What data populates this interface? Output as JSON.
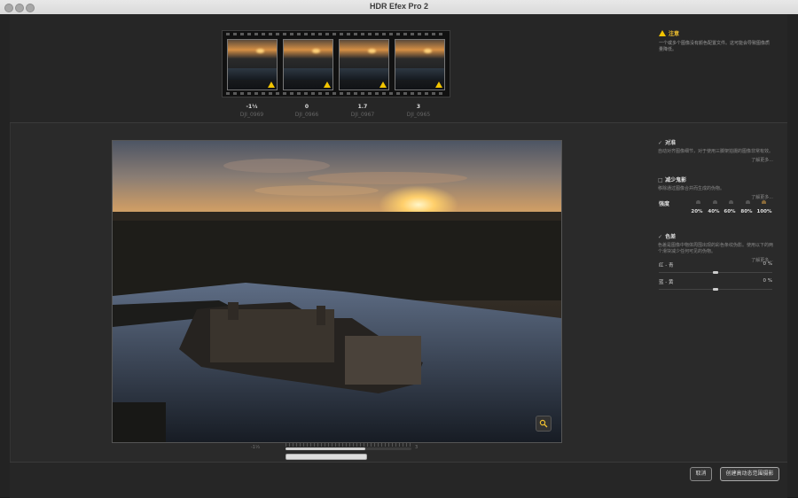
{
  "window": {
    "title": "HDR Efex Pro 2"
  },
  "filmstrip": [
    {
      "ev": "-1⅓",
      "name": "DJI_0969"
    },
    {
      "ev": "0",
      "name": "DJI_0966"
    },
    {
      "ev": "1.7",
      "name": "DJI_0967"
    },
    {
      "ev": "3",
      "name": "DJI_0965"
    }
  ],
  "notice": {
    "title": "注意",
    "text": "一个或多个图像没有颜色配置文件。这可能会导致图像质量降低。"
  },
  "alignment": {
    "title": "对准",
    "description": "自动对齐图像细节，对于使用三脚架拍摄的图像非常有效。",
    "more": "了解更多...",
    "checked": true
  },
  "ghost": {
    "title": "减少鬼影",
    "description": "移除通过图像合并而生成的伪物。",
    "more": "了解更多...",
    "checked": false,
    "strength_label": "强度",
    "strengths": [
      "20%",
      "40%",
      "60%",
      "80%",
      "100%"
    ]
  },
  "chroma": {
    "title": "色差",
    "description": "色差是图像中物体周围出现的彩色条纹伪影。使用以下的两个滑块减少任何可见的伪物。",
    "more": "了解更多...",
    "checked": true,
    "red_cyan": {
      "label": "红 - 青",
      "value": "0 %"
    },
    "blue_yellow": {
      "label": "蓝 - 黄",
      "value": "0 %"
    }
  },
  "exposure_slider": {
    "min": "-1⅓",
    "max": "3"
  },
  "buttons": {
    "cancel": "取消",
    "create": "创建高动态范围摄影"
  },
  "icons": {
    "warning": "warning-triangle-icon",
    "zoom": "magnifier-icon"
  },
  "colors": {
    "warning": "#f2c400",
    "background": "#2a2a2a"
  }
}
